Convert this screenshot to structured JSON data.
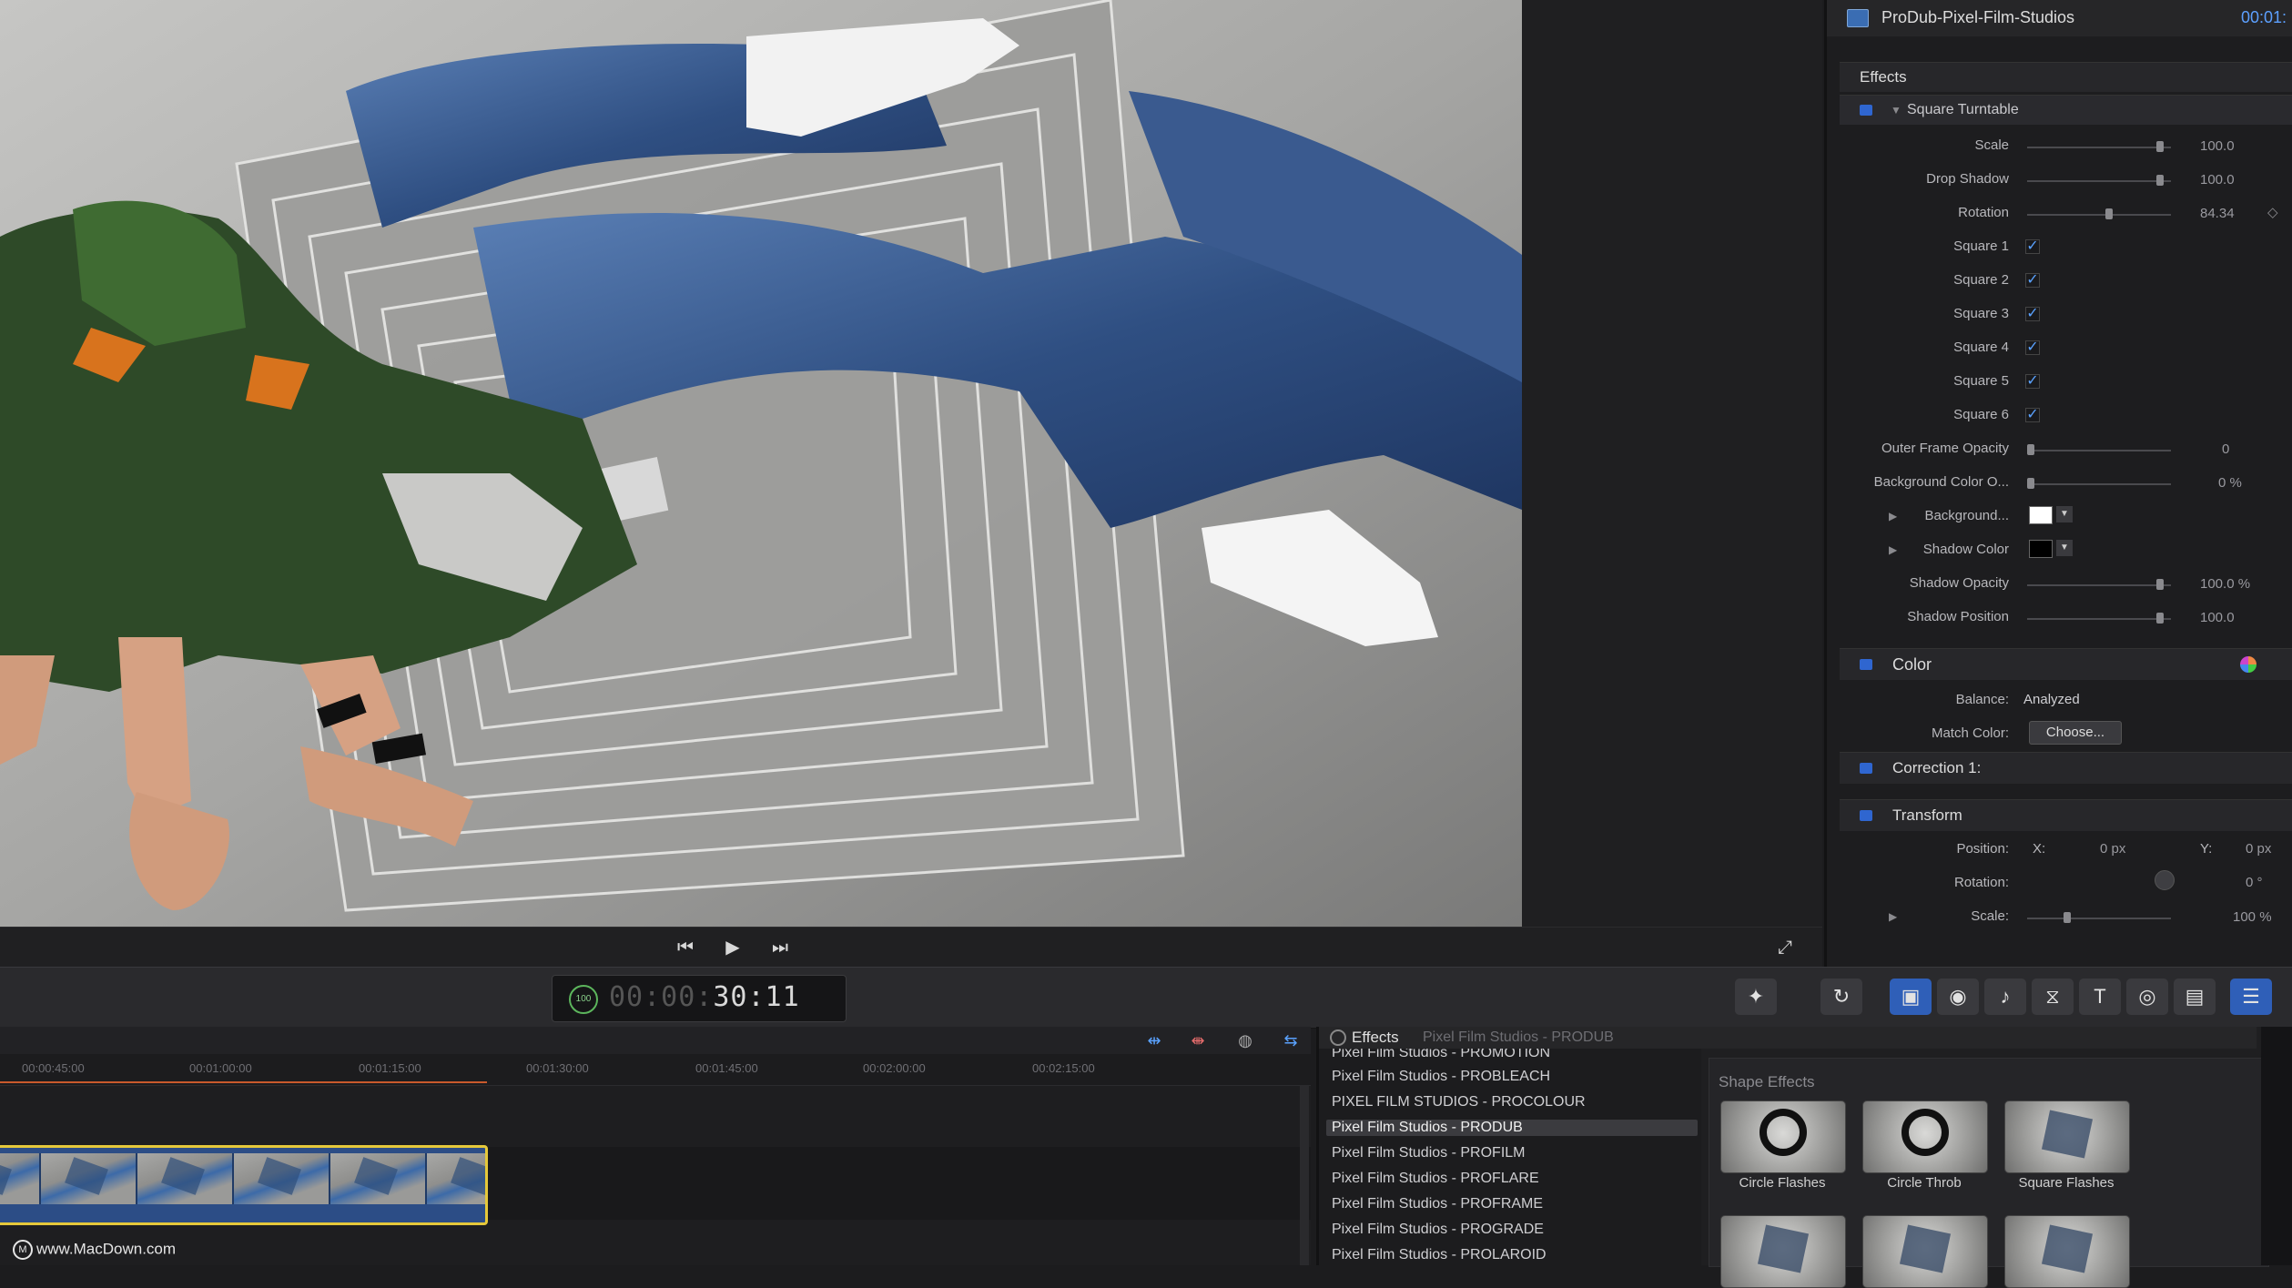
{
  "inspector": {
    "clip_title": "ProDub-Pixel-Film-Studios",
    "clip_timecode": "00:01:",
    "effects_header": "Effects",
    "effect_name": "Square Turntable",
    "params": [
      {
        "label": "Scale",
        "value": "100.0",
        "fill": 0.9
      },
      {
        "label": "Drop Shadow",
        "value": "100.0",
        "fill": 0.9
      },
      {
        "label": "Rotation",
        "value": "84.34",
        "fill": 0.55
      }
    ],
    "squares": [
      "Square 1",
      "Square 2",
      "Square 3",
      "Square 4",
      "Square 5",
      "Square 6"
    ],
    "outer_frame_opacity": {
      "label": "Outer Frame Opacity",
      "value": "0"
    },
    "bg_color_opacity": {
      "label": "Background Color O...",
      "value": "0 %"
    },
    "background": {
      "label": "Background...",
      "color": "#ffffff"
    },
    "shadow_color": {
      "label": "Shadow Color",
      "color": "#000000"
    },
    "shadow_opacity": {
      "label": "Shadow Opacity",
      "value": "100.0 %",
      "fill": 0.9
    },
    "shadow_position": {
      "label": "Shadow Position",
      "value": "100.0",
      "fill": 0.9
    },
    "color": {
      "title": "Color",
      "balance_label": "Balance:",
      "balance_value": "Analyzed",
      "match_label": "Match Color:",
      "match_button": "Choose...",
      "correction": "Correction 1:"
    },
    "transform": {
      "title": "Transform",
      "position_label": "Position:",
      "x_label": "X:",
      "x_value": "0 px",
      "y_label": "Y:",
      "y_value": "0 px",
      "rotation_label": "Rotation:",
      "rotation_value": "0 °",
      "scale_label": "Scale:",
      "scale_value": "100 %"
    }
  },
  "toolbar": {
    "timecode_badge": "100",
    "timecode_dim": "00:00:",
    "timecode": "30:11"
  },
  "timeline": {
    "ruler": [
      "00:00:45:00",
      "00:01:00:00",
      "00:01:15:00",
      "00:01:30:00",
      "00:01:45:00",
      "00:02:00:00",
      "00:02:15:00"
    ],
    "watermark": "www.MacDown.com"
  },
  "effects_browser": {
    "title": "Effects",
    "breadcrumb": "Pixel Film Studios - PRODUB",
    "items": [
      "Pixel Film Studios - PROMOTION",
      "Pixel Film Studios - PROBLEACH",
      "PIXEL FILM STUDIOS - PROCOLOUR",
      "Pixel Film Studios - PRODUB",
      "Pixel Film Studios - PROFILM",
      "Pixel Film Studios - PROFLARE",
      "Pixel Film Studios - PROFRAME",
      "Pixel Film Studios - PROGRADE",
      "Pixel Film Studios - PROLAROID"
    ],
    "selected_index": 3,
    "shape_effects_title": "Shape Effects",
    "thumbs": [
      "Circle Flashes",
      "Circle Throb",
      "Square Flashes"
    ]
  },
  "colors": {
    "accent": "#2f66d0",
    "playhead": "#c9592c",
    "clip_border": "#e5c83a"
  }
}
